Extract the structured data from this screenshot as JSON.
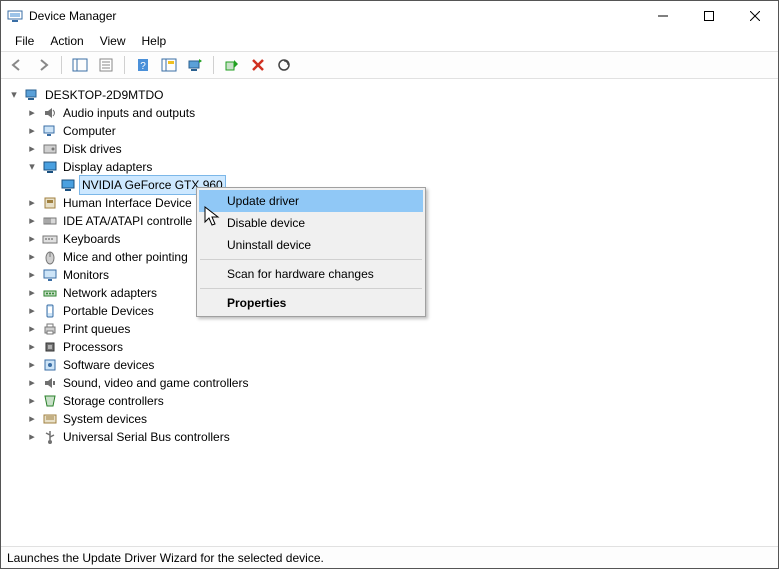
{
  "window": {
    "title": "Device Manager"
  },
  "menu": {
    "file": "File",
    "action": "Action",
    "view": "View",
    "help": "Help"
  },
  "tree": {
    "root": "DESKTOP-2D9MTDO",
    "items": [
      {
        "label": "Audio inputs and outputs",
        "icon": "speaker"
      },
      {
        "label": "Computer",
        "icon": "computer"
      },
      {
        "label": "Disk drives",
        "icon": "disk"
      },
      {
        "label": "Display adapters",
        "icon": "display",
        "expanded": true,
        "children": [
          {
            "label": "NVIDIA GeForce GTX 960",
            "icon": "display",
            "selected": true
          }
        ]
      },
      {
        "label": "Human Interface Device",
        "icon": "hid",
        "truncated": true
      },
      {
        "label": "IDE ATA/ATAPI controlle",
        "icon": "ide",
        "truncated": true
      },
      {
        "label": "Keyboards",
        "icon": "keyboard"
      },
      {
        "label": "Mice and other pointing",
        "icon": "mouse",
        "truncated": true
      },
      {
        "label": "Monitors",
        "icon": "monitor"
      },
      {
        "label": "Network adapters",
        "icon": "network"
      },
      {
        "label": "Portable Devices",
        "icon": "portable"
      },
      {
        "label": "Print queues",
        "icon": "printer"
      },
      {
        "label": "Processors",
        "icon": "cpu"
      },
      {
        "label": "Software devices",
        "icon": "software"
      },
      {
        "label": "Sound, video and game controllers",
        "icon": "sound"
      },
      {
        "label": "Storage controllers",
        "icon": "storage"
      },
      {
        "label": "System devices",
        "icon": "system"
      },
      {
        "label": "Universal Serial Bus controllers",
        "icon": "usb"
      }
    ]
  },
  "context_menu": {
    "update": "Update driver",
    "disable": "Disable device",
    "uninstall": "Uninstall device",
    "scan": "Scan for hardware changes",
    "properties": "Properties"
  },
  "status": "Launches the Update Driver Wizard for the selected device."
}
